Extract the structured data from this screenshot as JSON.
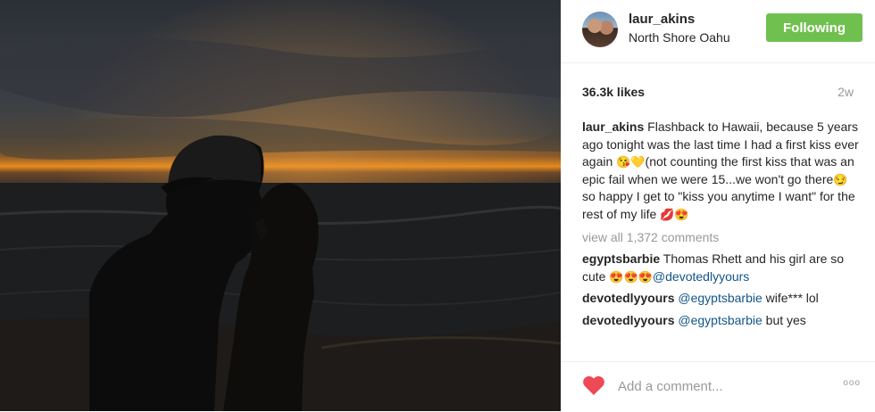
{
  "post": {
    "photo_alt": "Silhouette of couple kissing at sunset on beach",
    "header": {
      "username": "laur_akins",
      "location": "North Shore Oahu",
      "follow_label": "Following"
    },
    "likes": "36.3k likes",
    "time": "2w",
    "caption": {
      "username": "laur_akins",
      "text_1": "Flashback to Hawaii, because 5 years ago tonight was the last time I had a first kiss ever again ",
      "emoji_1": "😘💛",
      "text_2": "(not counting the first kiss that was an epic fail when we were 15...we won't go there",
      "emoji_2": "😏",
      "text_3": " so happy I get to \"kiss you anytime I want\" for the rest of my life ",
      "emoji_3": "💋😍"
    },
    "view_all": "view all 1,372 comments",
    "comments": [
      {
        "username": "egyptsbarbie",
        "text": " Thomas Rhett and his girl are so cute ",
        "emoji": "😍😍😍",
        "mention": "@devotedlyyours",
        "after": ""
      },
      {
        "username": "devotedlyyours",
        "text": " ",
        "emoji": "",
        "mention": "@egyptsbarbie",
        "after": " wife*** lol"
      },
      {
        "username": "devotedlyyours",
        "text": " ",
        "emoji": "",
        "mention": "@egyptsbarbie",
        "after": " but yes"
      }
    ],
    "footer": {
      "placeholder": "Add a comment...",
      "more_label": "ooo",
      "like_color": "#ed4956"
    }
  }
}
